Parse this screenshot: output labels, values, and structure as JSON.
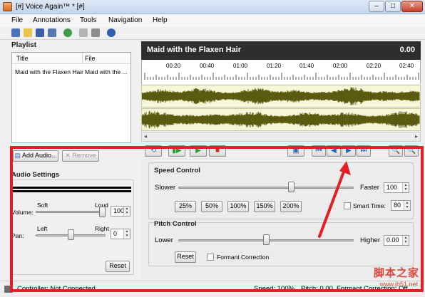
{
  "window": {
    "title": "[#] Voice Again™ * [#]",
    "min": "–",
    "max": "□",
    "close": "✕"
  },
  "menu": [
    "File",
    "Annotations",
    "Tools",
    "Navigation",
    "Help"
  ],
  "toolbar_icons": [
    "new-icon",
    "open-icon",
    "save-icon",
    "save-as-icon",
    "globe-icon",
    "filter-icon",
    "edit-icon",
    "help-icon"
  ],
  "playlist": {
    "title": "Playlist",
    "columns": [
      "Title",
      "File"
    ],
    "rows": [
      {
        "title": "Maid with the Flaxen Hair",
        "file": "Maid with the ..."
      }
    ]
  },
  "track": {
    "title": "Maid with the Flaxen Hair",
    "time": "0.00",
    "ticks": [
      "00:20",
      "00:40",
      "01:00",
      "01:20",
      "01:40",
      "02:00",
      "02:20",
      "02:40"
    ]
  },
  "buttons": {
    "add_audio": "Add Audio...",
    "remove": "Remove",
    "reset": "Reset"
  },
  "audio_settings": {
    "title": "Audio Settings",
    "volume_label": "Volume:",
    "soft": "Soft",
    "loud": "Loud",
    "volume_value": "100",
    "pan_label": "Pan:",
    "left": "Left",
    "right": "Right",
    "pan_value": "0",
    "volume_level": 1.0,
    "pan_level": 0.5
  },
  "speed_control": {
    "title": "Speed Control",
    "slower": "Slower",
    "faster": "Faster",
    "value": "100",
    "level": 0.65,
    "presets": [
      "25%",
      "50%",
      "100%",
      "150%",
      "200%"
    ],
    "smart_time_label": "Smart Time:",
    "smart_time_value": "80"
  },
  "pitch_control": {
    "title": "Pitch Control",
    "lower": "Lower",
    "higher": "Higher",
    "value": "0.00",
    "level": 0.5,
    "reset": "Reset",
    "formant_label": "Formant Correction"
  },
  "status": {
    "controller": "Controller: Not Connected",
    "speed": "Speed: 100%",
    "pitch": "Pitch: 0.00",
    "formant": "Formant Correction: Off"
  },
  "watermark": {
    "text": "脚本之家",
    "url": "www.jb51.net"
  },
  "colors": {
    "annotation_red": "#e41e25",
    "waveform": "#5a5a10",
    "header": "#2e2e2e"
  }
}
